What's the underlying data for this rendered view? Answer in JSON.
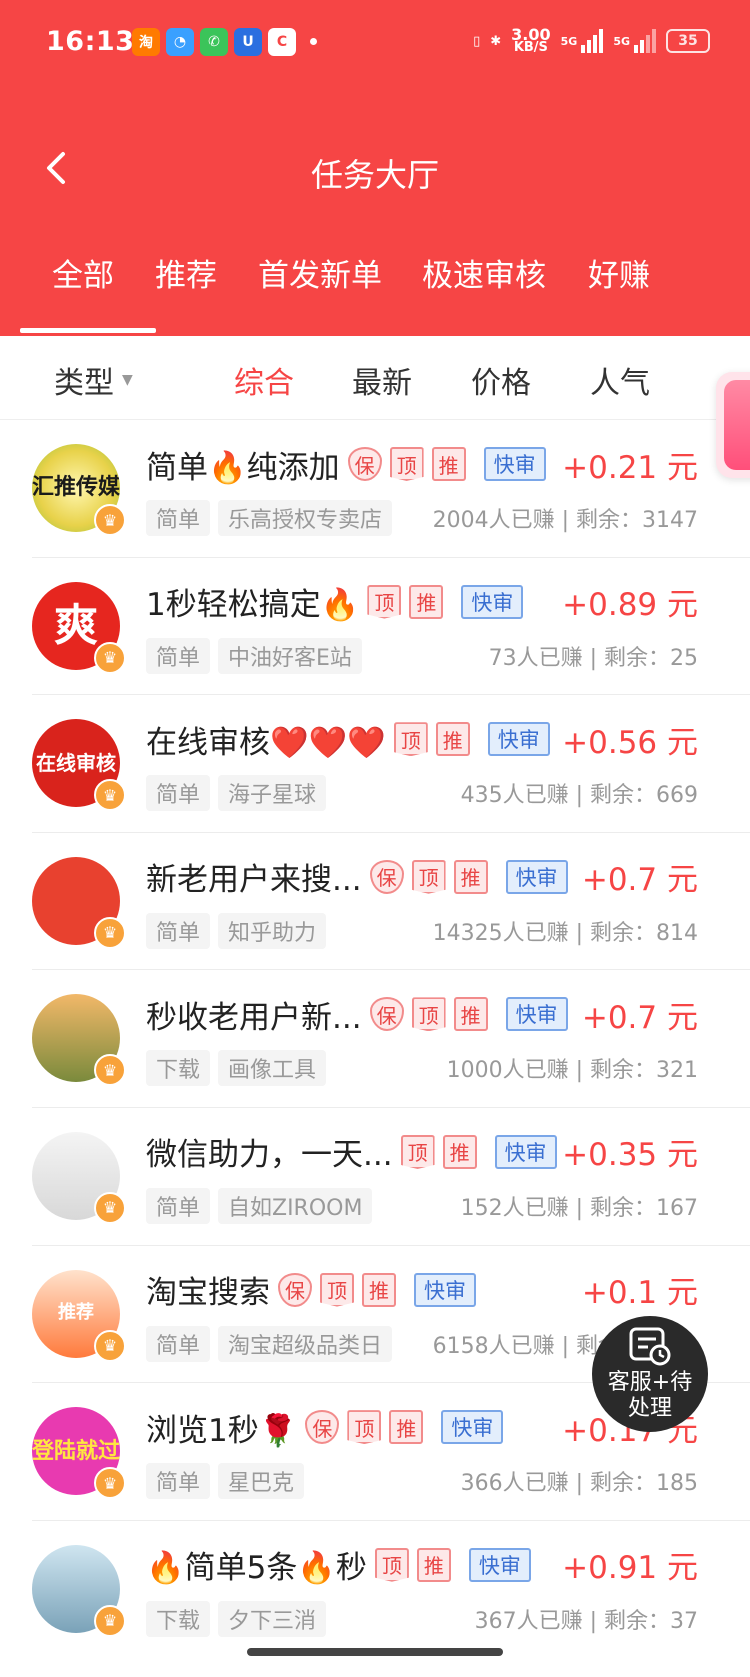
{
  "status": {
    "time": "16:13",
    "net_speed": "3.00",
    "net_unit": "KB/S",
    "sig1": "5G",
    "sig2": "5G",
    "battery": "35"
  },
  "header": {
    "title": "任务大厅"
  },
  "tabs": [
    "全部",
    "推荐",
    "首发新单",
    "极速审核",
    "好赚"
  ],
  "filter": {
    "type_label": "类型",
    "sorts": [
      "综合",
      "最新",
      "价格",
      "人气"
    ]
  },
  "badges": {
    "bao": "保",
    "ding": "顶",
    "tui": "推",
    "fast": "快审"
  },
  "tasks": [
    {
      "title": "简单🔥纯添加",
      "badges": [
        "bao",
        "ding",
        "tui",
        "fast"
      ],
      "price": "+0.21 元",
      "category": "简单",
      "shop": "乐高授权专卖店",
      "stats": "2004人已赚 | 剩余：3147",
      "avatar_text": "汇推传媒"
    },
    {
      "title": "1秒轻松搞定🔥",
      "badges": [
        "ding",
        "tui",
        "fast"
      ],
      "price": "+0.89 元",
      "category": "简单",
      "shop": "中油好客E站",
      "stats": "73人已赚 | 剩余：25",
      "avatar_text": "爽"
    },
    {
      "title": "在线审核❤️❤️❤️",
      "badges": [
        "ding",
        "tui",
        "fast"
      ],
      "price": "+0.56 元",
      "category": "简单",
      "shop": "海子星球",
      "stats": "435人已赚 | 剩余：669",
      "avatar_text": "在线审核"
    },
    {
      "title": "新老用户来搜...",
      "badges": [
        "bao",
        "ding",
        "tui",
        "fast"
      ],
      "price": "+0.7 元",
      "category": "简单",
      "shop": "知乎助力",
      "stats": "14325人已赚 | 剩余：814",
      "avatar_text": ""
    },
    {
      "title": "秒收老用户新...",
      "badges": [
        "bao",
        "ding",
        "tui",
        "fast"
      ],
      "price": "+0.7 元",
      "category": "下载",
      "shop": "画像工具",
      "stats": "1000人已赚 | 剩余：321",
      "avatar_text": ""
    },
    {
      "title": "微信助力，一天...",
      "badges": [
        "ding",
        "tui",
        "fast"
      ],
      "price": "+0.35 元",
      "category": "简单",
      "shop": "自如ZIROOM",
      "stats": "152人已赚 | 剩余：167",
      "avatar_text": ""
    },
    {
      "title": "淘宝搜索",
      "badges": [
        "bao",
        "ding",
        "tui",
        "fast"
      ],
      "price": "+0.1 元",
      "category": "简单",
      "shop": "淘宝超级品类日",
      "stats": "6158人已赚 | 剩余：7068",
      "avatar_text": "推荐"
    },
    {
      "title": "浏览1秒🌹",
      "badges": [
        "bao",
        "ding",
        "tui",
        "fast"
      ],
      "price": "+0.17 元",
      "category": "简单",
      "shop": "星巴克",
      "stats": "366人已赚 | 剩余：185",
      "avatar_text": "登陆就过"
    },
    {
      "title": "🔥简单5条🔥秒",
      "badges": [
        "ding",
        "tui",
        "fast"
      ],
      "price": "+0.91 元",
      "category": "下载",
      "shop": "夕下三消",
      "stats": "367人已赚 | 剩余：37",
      "avatar_text": ""
    }
  ],
  "customer_service": {
    "label": "客服+待处理"
  },
  "colors": {
    "brand": "#f64545",
    "fast_badge": "#3a6fd1"
  }
}
